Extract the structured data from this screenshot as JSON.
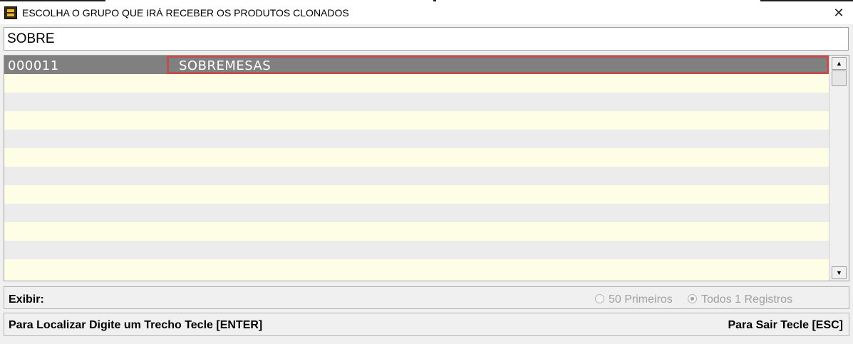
{
  "window": {
    "title": "ESCOLHA O GRUPO QUE IRÁ RECEBER OS PRODUTOS CLONADOS",
    "app_icon": "register-icon",
    "close_glyph": "✕"
  },
  "search": {
    "value": "SOBRE"
  },
  "grid": {
    "rows": [
      {
        "code": "000011",
        "name": "SOBREMESAS",
        "selected": true
      }
    ],
    "scroll_up_glyph": "▲",
    "scroll_down_glyph": "▼"
  },
  "exibir": {
    "label": "Exibir:",
    "option_first": "50 Primeiros",
    "option_all": "Todos 1 Registros",
    "selected": "option_all"
  },
  "status": {
    "left": "Para Localizar Digite um Trecho Tecle [ENTER]",
    "right": "Para Sair Tecle [ESC]"
  },
  "colors": {
    "selected_row": "#808080",
    "even_row": "#fefee6",
    "odd_row": "#ececec",
    "focus_border": "#c0504d"
  }
}
